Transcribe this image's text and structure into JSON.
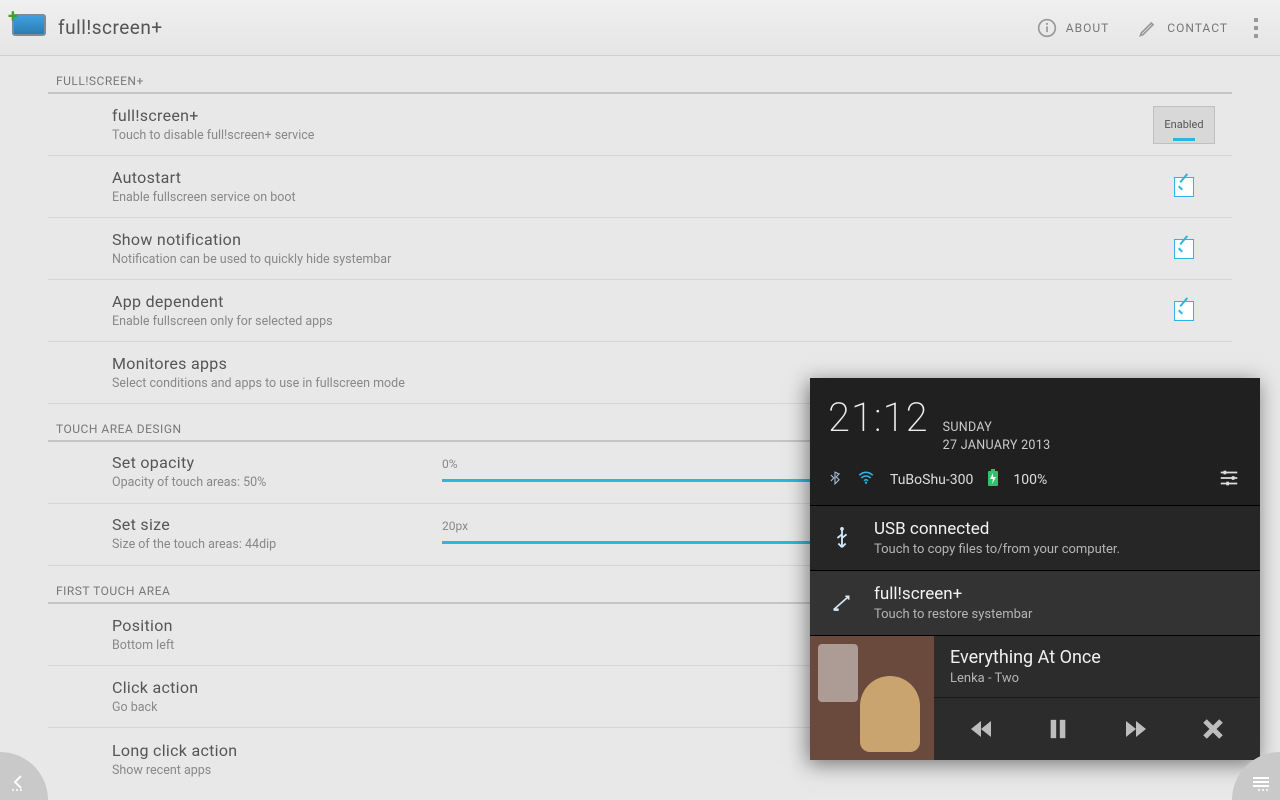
{
  "header": {
    "title": "full!screen+",
    "about": "ABOUT",
    "contact": "CONTACT"
  },
  "sections": {
    "s1": {
      "header": "FULL!SCREEN+"
    },
    "s2": {
      "header": "TOUCH AREA DESIGN"
    },
    "s3": {
      "header": "FIRST TOUCH AREA"
    }
  },
  "rows": {
    "enable": {
      "title": "full!screen+",
      "sub": "Touch to disable full!screen+ service",
      "chip": "Enabled"
    },
    "autostart": {
      "title": "Autostart",
      "sub": "Enable fullscreen service on boot"
    },
    "notif": {
      "title": "Show notification",
      "sub": "Notification can be used to quickly hide systembar"
    },
    "appdep": {
      "title": "App dependent",
      "sub": "Enable fullscreen only for selected apps"
    },
    "monapps": {
      "title": "Monitores apps",
      "sub": "Select conditions and apps to use in fullscreen mode"
    },
    "opacity": {
      "title": "Set opacity",
      "sub": "Opacity of touch areas: 50%",
      "value": "0%"
    },
    "size": {
      "title": "Set size",
      "sub": "Size of the touch areas: 44dip",
      "value": "20px"
    },
    "position": {
      "title": "Position",
      "sub": "Bottom left"
    },
    "click": {
      "title": "Click action",
      "sub": "Go back"
    },
    "longclick": {
      "title": "Long click action",
      "sub": "Show recent apps"
    }
  },
  "shade": {
    "time": "21:12",
    "day": "SUNDAY",
    "date": "27 JANUARY 2013",
    "wifi": "TuBoShu-300",
    "battery": "100%",
    "notif1": {
      "title": "USB connected",
      "sub": "Touch to copy files to/from your computer."
    },
    "notif2": {
      "title": "full!screen+",
      "sub": "Touch to restore systembar"
    },
    "music": {
      "title": "Everything At Once",
      "sub": "Lenka - Two"
    }
  }
}
